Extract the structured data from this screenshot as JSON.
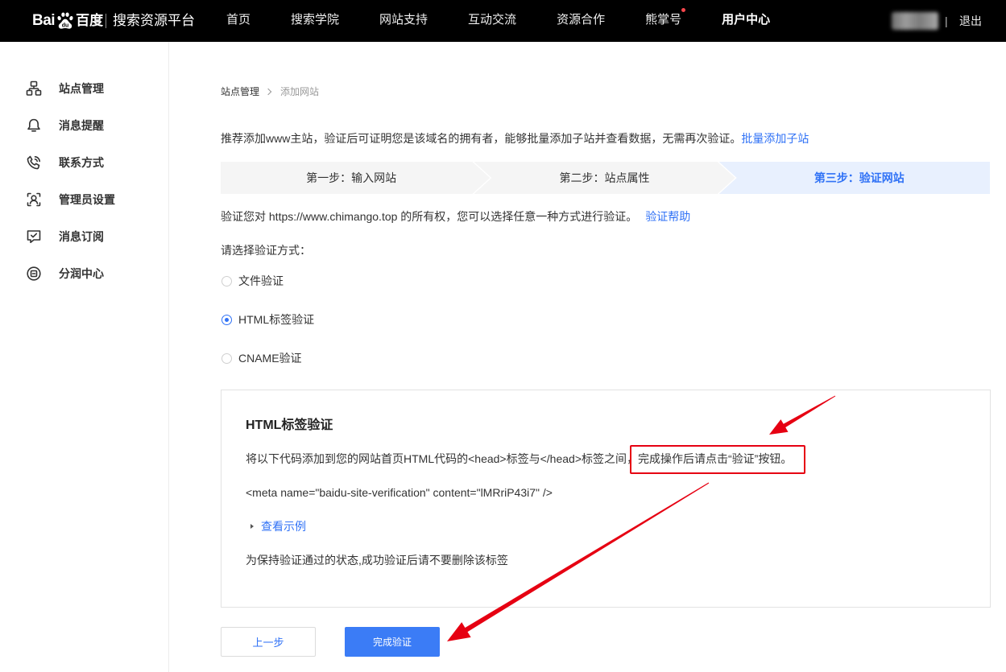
{
  "header": {
    "logo": {
      "bai": "Bai",
      "du": "du",
      "baidu_cn": "百度"
    },
    "platform_name": "搜索资源平台",
    "nav": [
      {
        "label": "首页"
      },
      {
        "label": "搜索学院"
      },
      {
        "label": "网站支持"
      },
      {
        "label": "互动交流"
      },
      {
        "label": "资源合作"
      },
      {
        "label": "熊掌号",
        "has_red_dot": true
      },
      {
        "label": "用户中心",
        "active": true
      }
    ],
    "separator": "|",
    "logout": "退出"
  },
  "sidebar": {
    "items": [
      {
        "label": "站点管理",
        "icon": "sitemap-icon"
      },
      {
        "label": "消息提醒",
        "icon": "bell-icon"
      },
      {
        "label": "联系方式",
        "icon": "phone-icon"
      },
      {
        "label": "管理员设置",
        "icon": "admin-card-icon"
      },
      {
        "label": "消息订阅",
        "icon": "chat-check-icon"
      },
      {
        "label": "分润中心",
        "icon": "profit-circle-icon"
      }
    ]
  },
  "breadcrumb": {
    "root": "站点管理",
    "separator_icon": "chevron-right-icon",
    "current": "添加网站"
  },
  "intro": {
    "text": "推荐添加www主站，验证后可证明您是该域名的拥有者，能够批量添加子站并查看数据，无需再次验证。",
    "link": "批量添加子站"
  },
  "steps": [
    {
      "label": "第一步：输入网站",
      "active": false
    },
    {
      "label": "第二步：站点属性",
      "active": false
    },
    {
      "label": "第三步：验证网站",
      "active": true
    }
  ],
  "verify_intro": {
    "text": "验证您对 https://www.chimango.top 的所有权，您可以选择任意一种方式进行验证。",
    "link": "验证帮助"
  },
  "method_prompt": "请选择验证方式：",
  "methods": [
    {
      "label": "文件验证",
      "selected": false
    },
    {
      "label": "HTML标签验证",
      "selected": true
    },
    {
      "label": "CNAME验证",
      "selected": false
    }
  ],
  "panel": {
    "title": "HTML标签验证",
    "instruction_before": "将以下代码添加到您的网站首页HTML代码的<head>标签与</head>标签之间，",
    "instruction_highlight": "完成操作后请点击“验证”按钮。",
    "code": "<meta name=\"baidu-site-verification\" content=\"lMRriP43i7\" />",
    "example_icon": "caret-right-icon",
    "example_link": "查看示例",
    "note": "为保持验证通过的状态,成功验证后请不要删除该标签"
  },
  "buttons": {
    "prev": "上一步",
    "finish": "完成验证"
  },
  "colors": {
    "header_bg": "#000000",
    "accent": "#3072f6",
    "button": "#3b7cf6",
    "active_step_bg": "#e8f0fe",
    "annotation": "#e60012"
  }
}
